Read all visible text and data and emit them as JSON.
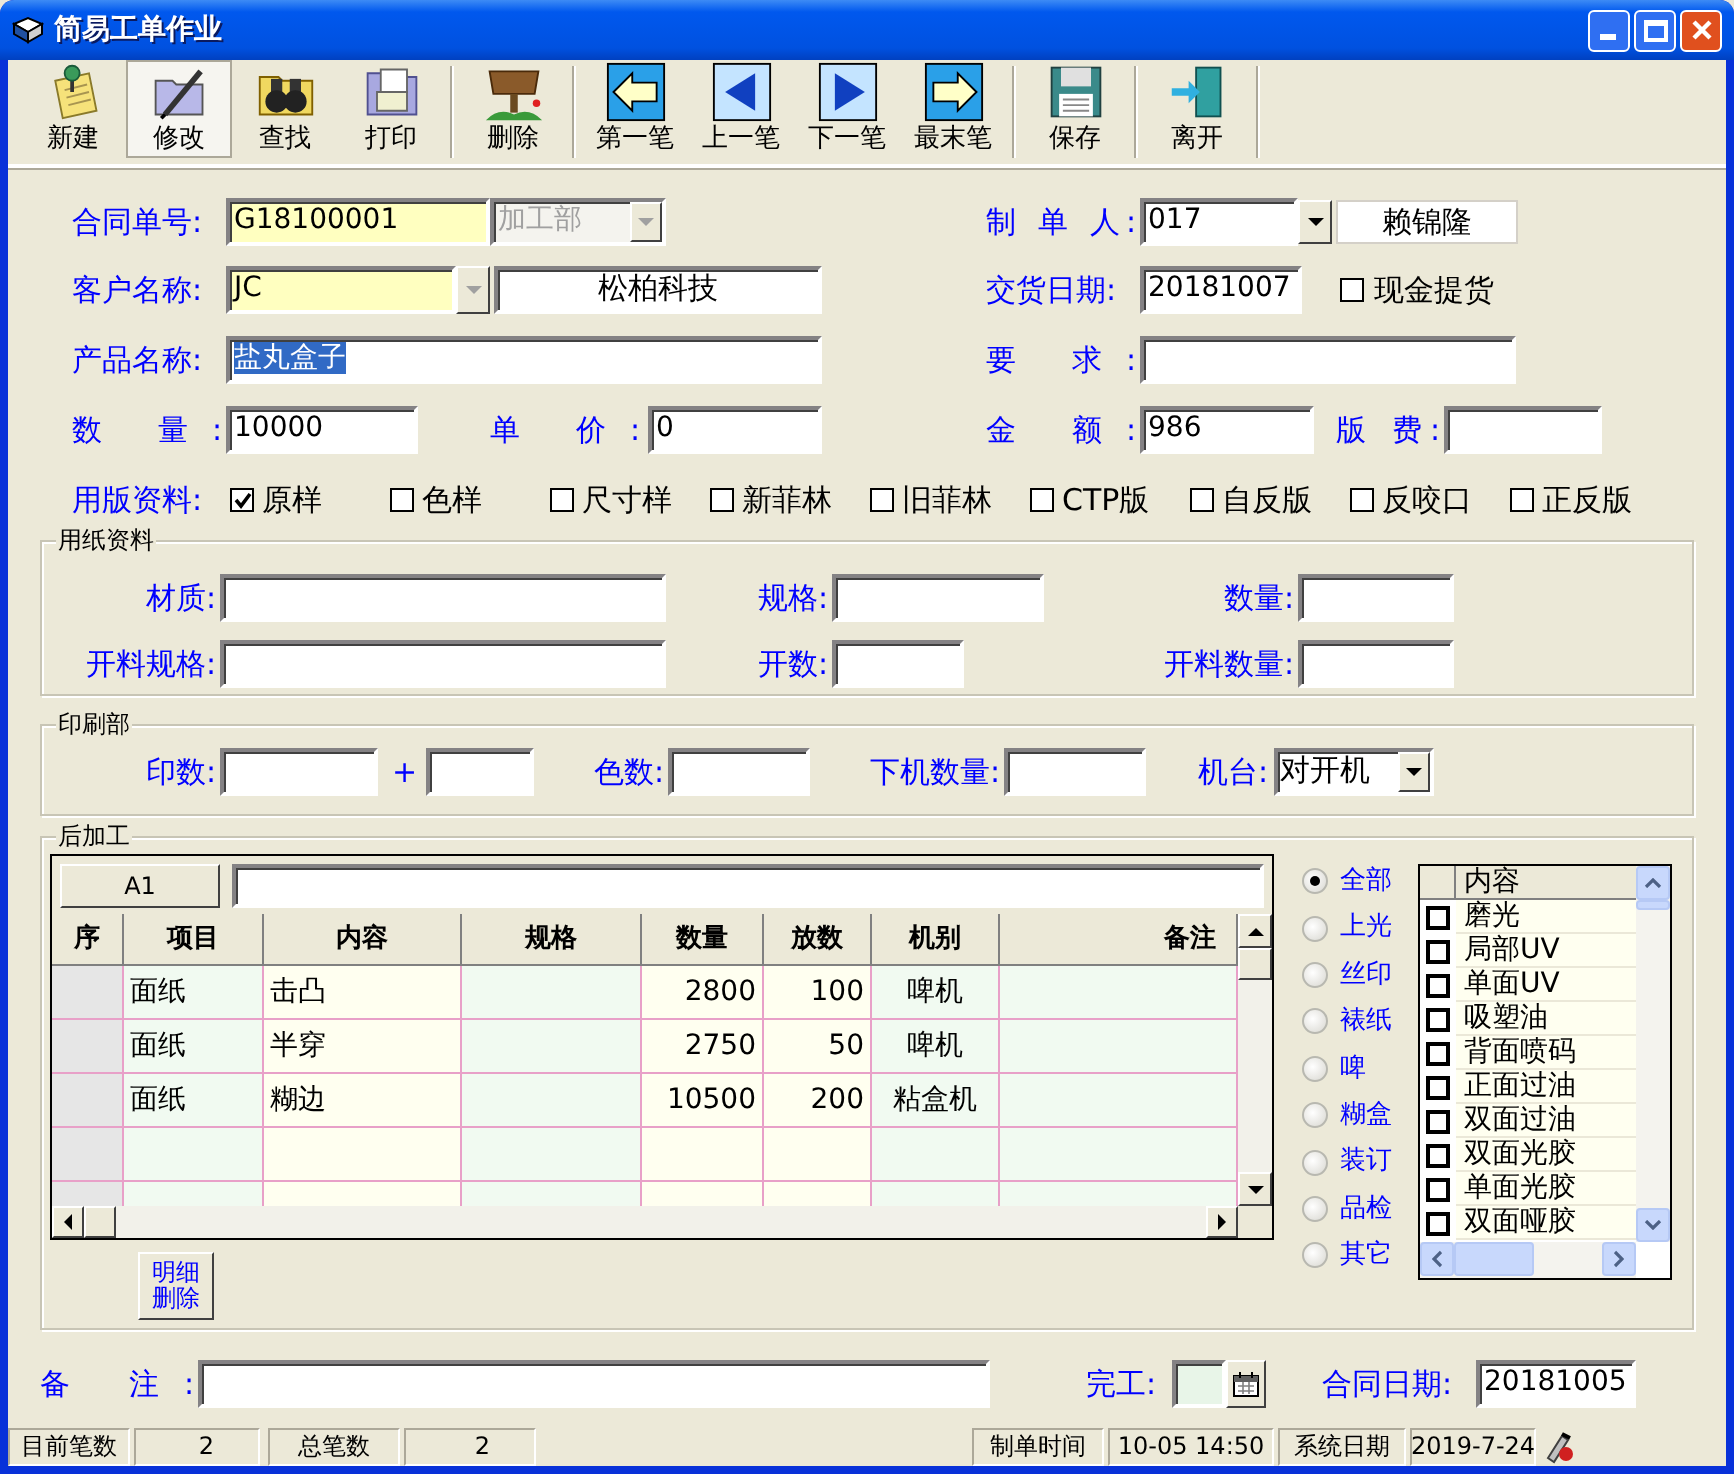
{
  "window": {
    "title": "简易工单作业"
  },
  "toolbar": [
    {
      "label": "新建",
      "selected": false
    },
    {
      "label": "修改",
      "selected": true
    },
    {
      "label": "查找",
      "selected": false
    },
    {
      "label": "打印",
      "selected": false
    },
    {
      "label": "删除",
      "selected": false
    },
    {
      "label": "第一笔",
      "selected": false
    },
    {
      "label": "上一笔",
      "selected": false
    },
    {
      "label": "下一笔",
      "selected": false
    },
    {
      "label": "最末笔",
      "selected": false
    },
    {
      "label": "保存",
      "selected": false
    },
    {
      "label": "离开",
      "selected": false
    }
  ],
  "order": {
    "contract_no": {
      "label": "合同单号:",
      "value": "G18100001"
    },
    "department": {
      "value": "加工部",
      "disabled": true
    },
    "maker": {
      "label": "制 单 人:",
      "value": "017",
      "name": "赖锦隆"
    },
    "customer": {
      "label": "客户名称:",
      "value": "JC",
      "name": "松柏科技"
    },
    "delivery_date": {
      "label": "交货日期:",
      "value": "20181007"
    },
    "cash_pickup": {
      "label": "现金提货",
      "checked": false
    },
    "product": {
      "label": "产品名称:",
      "value": "盐丸盒子",
      "highlighted": true
    },
    "requirement": {
      "label": "要 求:"
    },
    "quantity": {
      "label": "数 量:",
      "value": "10000"
    },
    "unit_price": {
      "label": "单 价:",
      "value": "0"
    },
    "amount": {
      "label": "金 额:",
      "value": "986"
    },
    "plate_fee": {
      "label": "版 费:"
    }
  },
  "plate_materials": {
    "label": "用版资料:",
    "options": [
      {
        "label": "原样",
        "checked": true
      },
      {
        "label": "色样",
        "checked": false
      },
      {
        "label": "尺寸样",
        "checked": false
      },
      {
        "label": "新菲林",
        "checked": false
      },
      {
        "label": "旧菲林",
        "checked": false
      },
      {
        "label": "CTP版",
        "checked": false
      },
      {
        "label": "自反版",
        "checked": false
      },
      {
        "label": "反咬口",
        "checked": false
      },
      {
        "label": "正反版",
        "checked": false
      }
    ]
  },
  "paper": {
    "title": "用纸资料",
    "fields": [
      {
        "label": "材质:"
      },
      {
        "label": "规格:"
      },
      {
        "label": "数量:"
      },
      {
        "label": "开料规格:"
      },
      {
        "label": "开数:"
      },
      {
        "label": "开料数量:"
      }
    ]
  },
  "printing": {
    "title": "印刷部",
    "prints": {
      "label": "印数:"
    },
    "plus": "+",
    "colors": {
      "label": "色数:"
    },
    "output_qty": {
      "label": "下机数量:"
    },
    "machine": {
      "label": "机台:",
      "value": "对开机"
    }
  },
  "post_press": {
    "title": "后加工",
    "cell_ref": "A1",
    "table": {
      "columns": [
        "序",
        "项目",
        "内容",
        "规格",
        "数量",
        "放数",
        "机别",
        "备注"
      ],
      "rows": [
        {
          "item": "面纸",
          "content": "击凸",
          "quantity": "2800",
          "spare": "100",
          "machine": "啤机"
        },
        {
          "item": "面纸",
          "content": "半穿",
          "quantity": "2750",
          "spare": "50",
          "machine": "啤机"
        },
        {
          "item": "面纸",
          "content": "糊边",
          "quantity": "10500",
          "spare": "200",
          "machine": "粘盒机"
        }
      ]
    },
    "delete_button": "明细删除",
    "categories": [
      {
        "label": "全部",
        "selected": true
      },
      {
        "label": "上光",
        "selected": false
      },
      {
        "label": "丝印",
        "selected": false
      },
      {
        "label": "裱纸",
        "selected": false
      },
      {
        "label": "啤",
        "selected": false
      },
      {
        "label": "糊盒",
        "selected": false
      },
      {
        "label": "装订",
        "selected": false
      },
      {
        "label": "品检",
        "selected": false
      },
      {
        "label": "其它",
        "selected": false
      }
    ],
    "process_list": {
      "column": "内容",
      "items": [
        {
          "label": "磨光",
          "checked": false
        },
        {
          "label": "局部UV",
          "checked": false
        },
        {
          "label": "单面UV",
          "checked": false
        },
        {
          "label": "吸塑油",
          "checked": false
        },
        {
          "label": "背面喷码",
          "checked": false
        },
        {
          "label": "正面过油",
          "checked": false
        },
        {
          "label": "双面过油",
          "checked": false
        },
        {
          "label": "双面光胶",
          "checked": false
        },
        {
          "label": "单面光胶",
          "checked": false
        },
        {
          "label": "双面哑胶",
          "checked": false
        }
      ]
    }
  },
  "remarks": {
    "label": "备 注:"
  },
  "completion": {
    "label": "完工:"
  },
  "contract_date": {
    "label": "合同日期:",
    "value": "20181005"
  },
  "status_bar": {
    "current_label": "目前笔数",
    "current": "2",
    "total_label": "总笔数",
    "total": "2",
    "created_label": "制单时间",
    "created": "10-05 14:50",
    "system_date_label": "系统日期",
    "system_date": "2019-7-24"
  }
}
